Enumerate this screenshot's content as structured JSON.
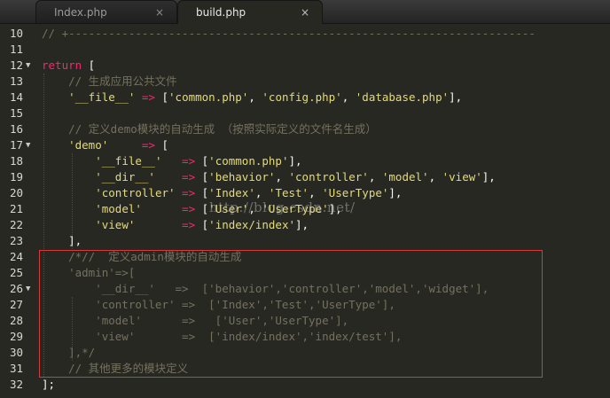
{
  "tabs": [
    {
      "label": "Index.php",
      "close": "×",
      "active": false
    },
    {
      "label": "build.php",
      "close": "×",
      "active": true
    }
  ],
  "line_numbers": [
    "10",
    "11",
    "12",
    "13",
    "14",
    "15",
    "16",
    "17",
    "18",
    "19",
    "20",
    "21",
    "22",
    "23",
    "24",
    "25",
    "26",
    "27",
    "28",
    "29",
    "30",
    "31",
    "32"
  ],
  "fold_marker": "▼",
  "lines": {
    "l10": [
      {
        "t": "// +----------------------------------------------------------------------",
        "c": "cm"
      }
    ],
    "l11": [],
    "l12": [
      {
        "t": "return",
        "c": "kw"
      },
      {
        "t": " [",
        "c": "pl"
      }
    ],
    "l13": [
      {
        "t": "    // 生成应用公共文件",
        "c": "cm"
      }
    ],
    "l14": [
      {
        "t": "    ",
        "c": "pl"
      },
      {
        "t": "'__file__'",
        "c": "st"
      },
      {
        "t": " => ",
        "c": "op"
      },
      {
        "t": "[",
        "c": "pl"
      },
      {
        "t": "'common.php'",
        "c": "st"
      },
      {
        "t": ", ",
        "c": "pl"
      },
      {
        "t": "'config.php'",
        "c": "st"
      },
      {
        "t": ", ",
        "c": "pl"
      },
      {
        "t": "'database.php'",
        "c": "st"
      },
      {
        "t": "],",
        "c": "pl"
      }
    ],
    "l15": [],
    "l16": [
      {
        "t": "    // 定义demo模块的自动生成 （按照实际定义的文件名生成）",
        "c": "cm"
      }
    ],
    "l17": [
      {
        "t": "    ",
        "c": "pl"
      },
      {
        "t": "'demo'",
        "c": "st"
      },
      {
        "t": "     => ",
        "c": "op"
      },
      {
        "t": "[",
        "c": "pl"
      }
    ],
    "l18": [
      {
        "t": "        ",
        "c": "pl"
      },
      {
        "t": "'__file__'",
        "c": "st"
      },
      {
        "t": "   => ",
        "c": "op"
      },
      {
        "t": "[",
        "c": "pl"
      },
      {
        "t": "'common.php'",
        "c": "st"
      },
      {
        "t": "],",
        "c": "pl"
      }
    ],
    "l19": [
      {
        "t": "        ",
        "c": "pl"
      },
      {
        "t": "'__dir__'",
        "c": "st"
      },
      {
        "t": "    => ",
        "c": "op"
      },
      {
        "t": "[",
        "c": "pl"
      },
      {
        "t": "'behavior'",
        "c": "st"
      },
      {
        "t": ", ",
        "c": "pl"
      },
      {
        "t": "'controller'",
        "c": "st"
      },
      {
        "t": ", ",
        "c": "pl"
      },
      {
        "t": "'model'",
        "c": "st"
      },
      {
        "t": ", ",
        "c": "pl"
      },
      {
        "t": "'view'",
        "c": "st"
      },
      {
        "t": "],",
        "c": "pl"
      }
    ],
    "l20": [
      {
        "t": "        ",
        "c": "pl"
      },
      {
        "t": "'controller'",
        "c": "st"
      },
      {
        "t": " => ",
        "c": "op"
      },
      {
        "t": "[",
        "c": "pl"
      },
      {
        "t": "'Index'",
        "c": "st"
      },
      {
        "t": ", ",
        "c": "pl"
      },
      {
        "t": "'Test'",
        "c": "st"
      },
      {
        "t": ", ",
        "c": "pl"
      },
      {
        "t": "'UserType'",
        "c": "st"
      },
      {
        "t": "],",
        "c": "pl"
      }
    ],
    "l21": [
      {
        "t": "        ",
        "c": "pl"
      },
      {
        "t": "'model'",
        "c": "st"
      },
      {
        "t": "      => ",
        "c": "op"
      },
      {
        "t": "[",
        "c": "pl"
      },
      {
        "t": "'User'",
        "c": "st"
      },
      {
        "t": ", ",
        "c": "pl"
      },
      {
        "t": "'UserType'",
        "c": "st"
      },
      {
        "t": "],",
        "c": "pl"
      }
    ],
    "l22": [
      {
        "t": "        ",
        "c": "pl"
      },
      {
        "t": "'view'",
        "c": "st"
      },
      {
        "t": "       => ",
        "c": "op"
      },
      {
        "t": "[",
        "c": "pl"
      },
      {
        "t": "'index/index'",
        "c": "st"
      },
      {
        "t": "],",
        "c": "pl"
      }
    ],
    "l23": [
      {
        "t": "    ],",
        "c": "pl"
      }
    ],
    "l24": [
      {
        "t": "    /*//  定义admin模块的自动生成",
        "c": "cm"
      }
    ],
    "l25": [
      {
        "t": "    'admin'=>[",
        "c": "cm"
      }
    ],
    "l26": [
      {
        "t": "        '__dir__'   =>  ['behavior','controller','model','widget'],",
        "c": "cm"
      }
    ],
    "l27": [
      {
        "t": "        'controller' =>  ['Index','Test','UserType'],",
        "c": "cm"
      }
    ],
    "l28": [
      {
        "t": "        'model'      =>   ['User','UserType'],",
        "c": "cm"
      }
    ],
    "l29": [
      {
        "t": "        'view'       =>  ['index/index','index/test'],",
        "c": "cm"
      }
    ],
    "l30": [
      {
        "t": "    ],*/",
        "c": "cm"
      }
    ],
    "l31": [
      {
        "t": "    // 其他更多的模块定义",
        "c": "cm"
      }
    ],
    "l32": [
      {
        "t": "];",
        "c": "pl"
      }
    ]
  },
  "watermark": "http://blog.csdn.net/",
  "colors": {
    "background": "#272822",
    "comment": "#75715e",
    "keyword": "#f92672",
    "string": "#e6db74",
    "plain": "#f8f8f2",
    "highlight_box": "#d63a3a"
  }
}
